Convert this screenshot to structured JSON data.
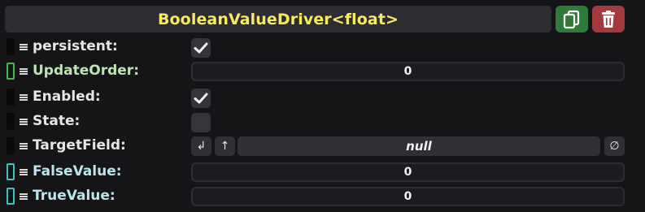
{
  "component": {
    "title": "BooleanValueDriver<float>",
    "duplicate_icon": "duplicate-icon",
    "delete_icon": "trash-icon"
  },
  "fields": {
    "persistent": {
      "label": "persistent:",
      "checked": true
    },
    "update_order": {
      "label": "UpdateOrder:",
      "value": "0"
    },
    "enabled": {
      "label": "Enabled:",
      "checked": true
    },
    "state": {
      "label": "State:",
      "checked": false
    },
    "target_field": {
      "label": "TargetField:",
      "value": "null",
      "jump_glyph": "↲",
      "up_glyph": "↑",
      "clear_glyph": "∅"
    },
    "false_value": {
      "label": "FalseValue:",
      "value": "0"
    },
    "true_value": {
      "label": "TrueValue:",
      "value": "0"
    }
  },
  "colors": {
    "title": "#f5ec5f",
    "duplicate_button": "#2f7a3b",
    "delete_button": "#a33a3e",
    "connector_green": "#43b94a",
    "connector_cyan": "#3cc4c4"
  }
}
